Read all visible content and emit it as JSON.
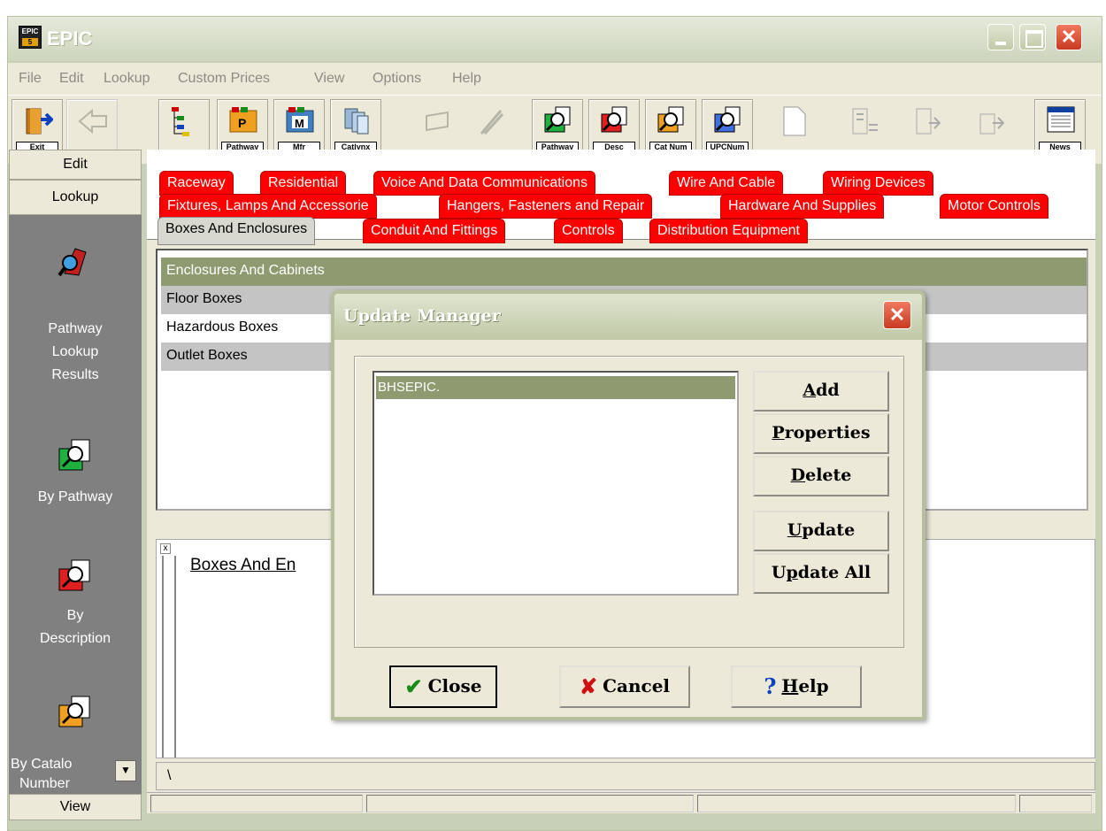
{
  "window": {
    "title": "EPIC",
    "icon_text": "EPIC",
    "icon_sub": "5"
  },
  "menu": [
    "File",
    "Edit",
    "Lookup",
    "Custom Prices",
    "View",
    "Options",
    "Help"
  ],
  "toolbar": {
    "buttons": [
      {
        "label": "Exit",
        "icon": "exit-door-icon"
      },
      {
        "label": "",
        "icon": "back-arrow-icon"
      },
      {
        "label": "",
        "icon": "tree-icon"
      },
      {
        "label": "Pathway",
        "icon": "pathway-folder-icon"
      },
      {
        "label": "Mfr",
        "icon": "manufacturer-folder-icon"
      },
      {
        "label": "Catlynx",
        "icon": "catlynx-icon"
      },
      {
        "label": "",
        "icon": "pipe-icon"
      },
      {
        "label": "",
        "icon": "fitting-icon"
      },
      {
        "label": "Pathway",
        "icon": "search-green-icon"
      },
      {
        "label": "Desc",
        "icon": "search-red-icon"
      },
      {
        "label": "Cat Num",
        "icon": "search-orange-icon"
      },
      {
        "label": "UPCNum",
        "icon": "search-blue-icon"
      },
      {
        "label": "",
        "icon": "blank-page-icon"
      },
      {
        "label": "",
        "icon": "report-icon"
      },
      {
        "label": "",
        "icon": "export-icon"
      },
      {
        "label": "",
        "icon": "import-icon"
      },
      {
        "label": "News",
        "icon": "news-icon"
      }
    ]
  },
  "sidebar": {
    "tabs": [
      "Edit",
      "Lookup"
    ],
    "links": [
      {
        "label_lines": [
          "Pathway",
          "Lookup",
          "Results"
        ],
        "icon": "pathway-results-icon"
      },
      {
        "label_lines": [
          "By Pathway"
        ],
        "icon": "search-green-icon"
      },
      {
        "label_lines": [
          "By",
          "Description"
        ],
        "icon": "search-red-icon"
      },
      {
        "label_lines": [
          "By Catalo",
          "Number"
        ],
        "icon": "search-orange-icon"
      }
    ],
    "bottom_tab": "View"
  },
  "tabs": {
    "row1": [
      "Raceway",
      "Residential",
      "Voice And Data Communications",
      "Wire And Cable",
      "Wiring Devices"
    ],
    "row2": [
      "Fixtures, Lamps And Accessorie",
      "Hangers, Fasteners and Repair",
      "Hardware And Supplies",
      "Motor Controls"
    ],
    "row3": [
      "Boxes And Enclosures",
      "Conduit And Fittings",
      "Controls",
      "Distribution Equipment"
    ],
    "active": "Boxes And Enclosures"
  },
  "list": {
    "items": [
      "Enclosures And Cabinets",
      "Floor Boxes",
      "Hazardous Boxes",
      "Outlet Boxes"
    ],
    "selected": "Enclosures And Cabinets"
  },
  "detail": {
    "link": "Boxes And En",
    "close": "x"
  },
  "pathbar": "\\",
  "dialog": {
    "title": "Update Manager",
    "close": "✕",
    "list_items": [
      "BHSEPIC."
    ],
    "buttons": {
      "add": {
        "pre": "",
        "u": "A",
        "post": "dd"
      },
      "properties": {
        "pre": "",
        "u": "P",
        "post": "roperties"
      },
      "delete": {
        "pre": "",
        "u": "D",
        "post": "elete"
      },
      "update": {
        "pre": "",
        "u": "U",
        "post": "pdate"
      },
      "update_all": {
        "pre": "U",
        "u": "p",
        "post": "date All"
      }
    },
    "bottom": {
      "close": "Close",
      "cancel": "Cancel",
      "help_u": "H",
      "help_rest": "elp"
    },
    "colors": {
      "check": "#1a8a1a",
      "cross": "#d01010",
      "help": "#1040c0"
    }
  },
  "colors": {
    "tab_red": "#ff0000",
    "selection": "#8e9a70",
    "sidebar": "#808080"
  }
}
